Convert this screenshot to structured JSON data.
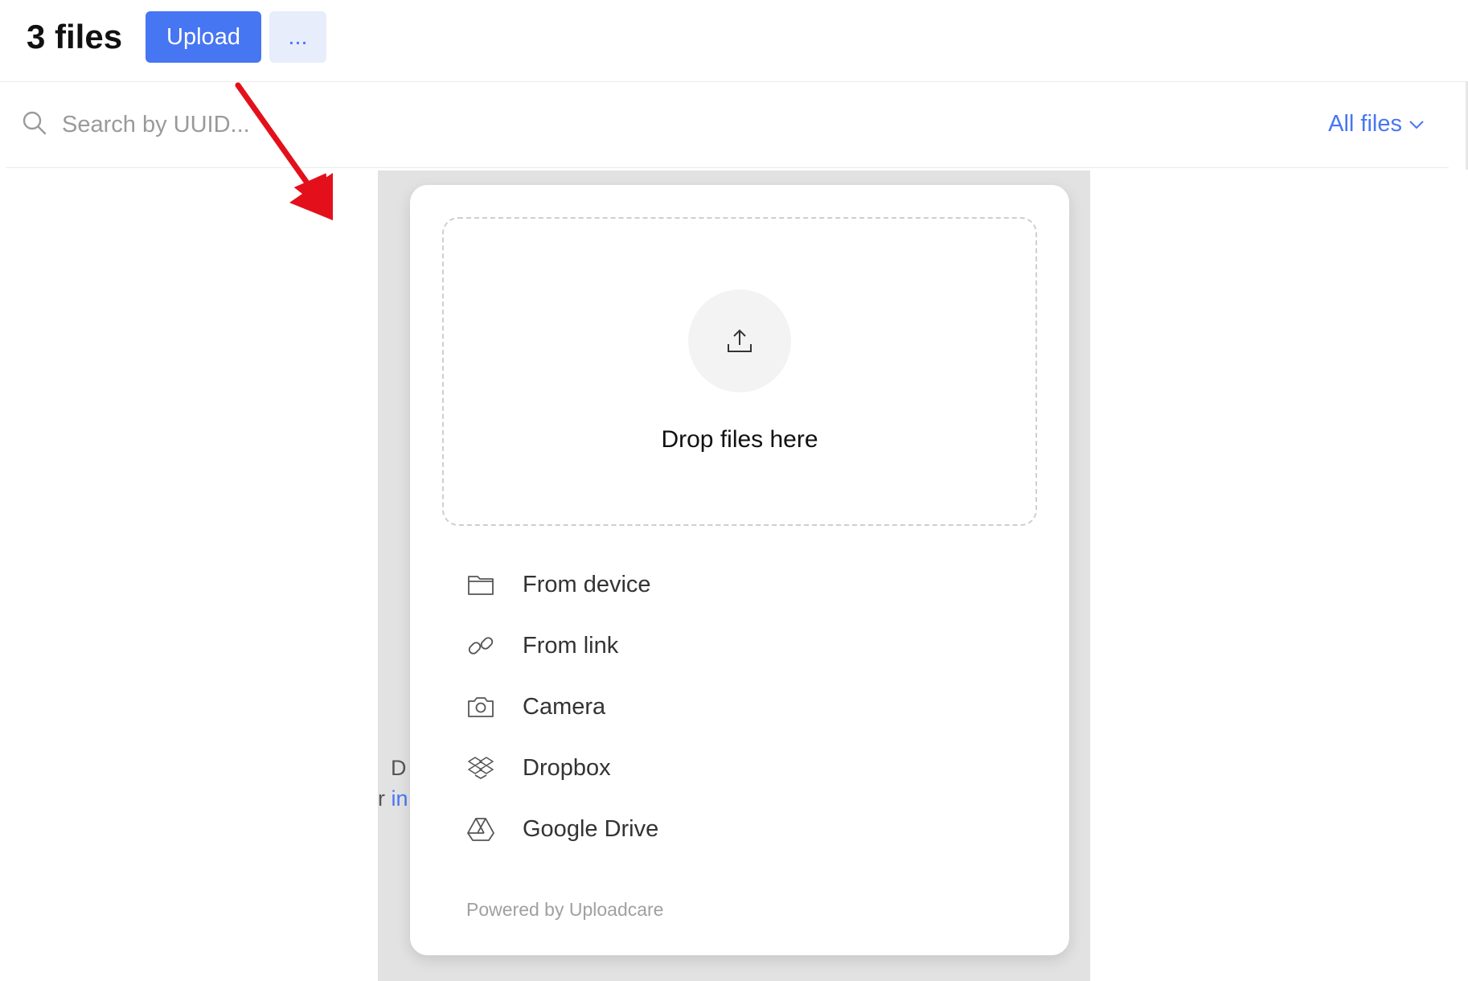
{
  "header": {
    "title": "3 files",
    "upload_label": "Upload",
    "more_label": "..."
  },
  "search": {
    "placeholder": "Search by UUID...",
    "filter_label": "All files"
  },
  "background_peek": {
    "letter_d": "D",
    "letter_r": "r",
    "link_fragment": "in"
  },
  "uploader": {
    "drop_label": "Drop files here",
    "sources": [
      {
        "label": "From device",
        "icon": "folder-icon"
      },
      {
        "label": "From link",
        "icon": "link-icon"
      },
      {
        "label": "Camera",
        "icon": "camera-icon"
      },
      {
        "label": "Dropbox",
        "icon": "dropbox-icon"
      },
      {
        "label": "Google Drive",
        "icon": "google-drive-icon"
      }
    ],
    "powered_by": "Powered by Uploadcare"
  },
  "colors": {
    "accent": "#4776f3",
    "accent_soft": "#e8edfc",
    "arrow": "#e3101b",
    "overlay": "#e2e2e2"
  }
}
